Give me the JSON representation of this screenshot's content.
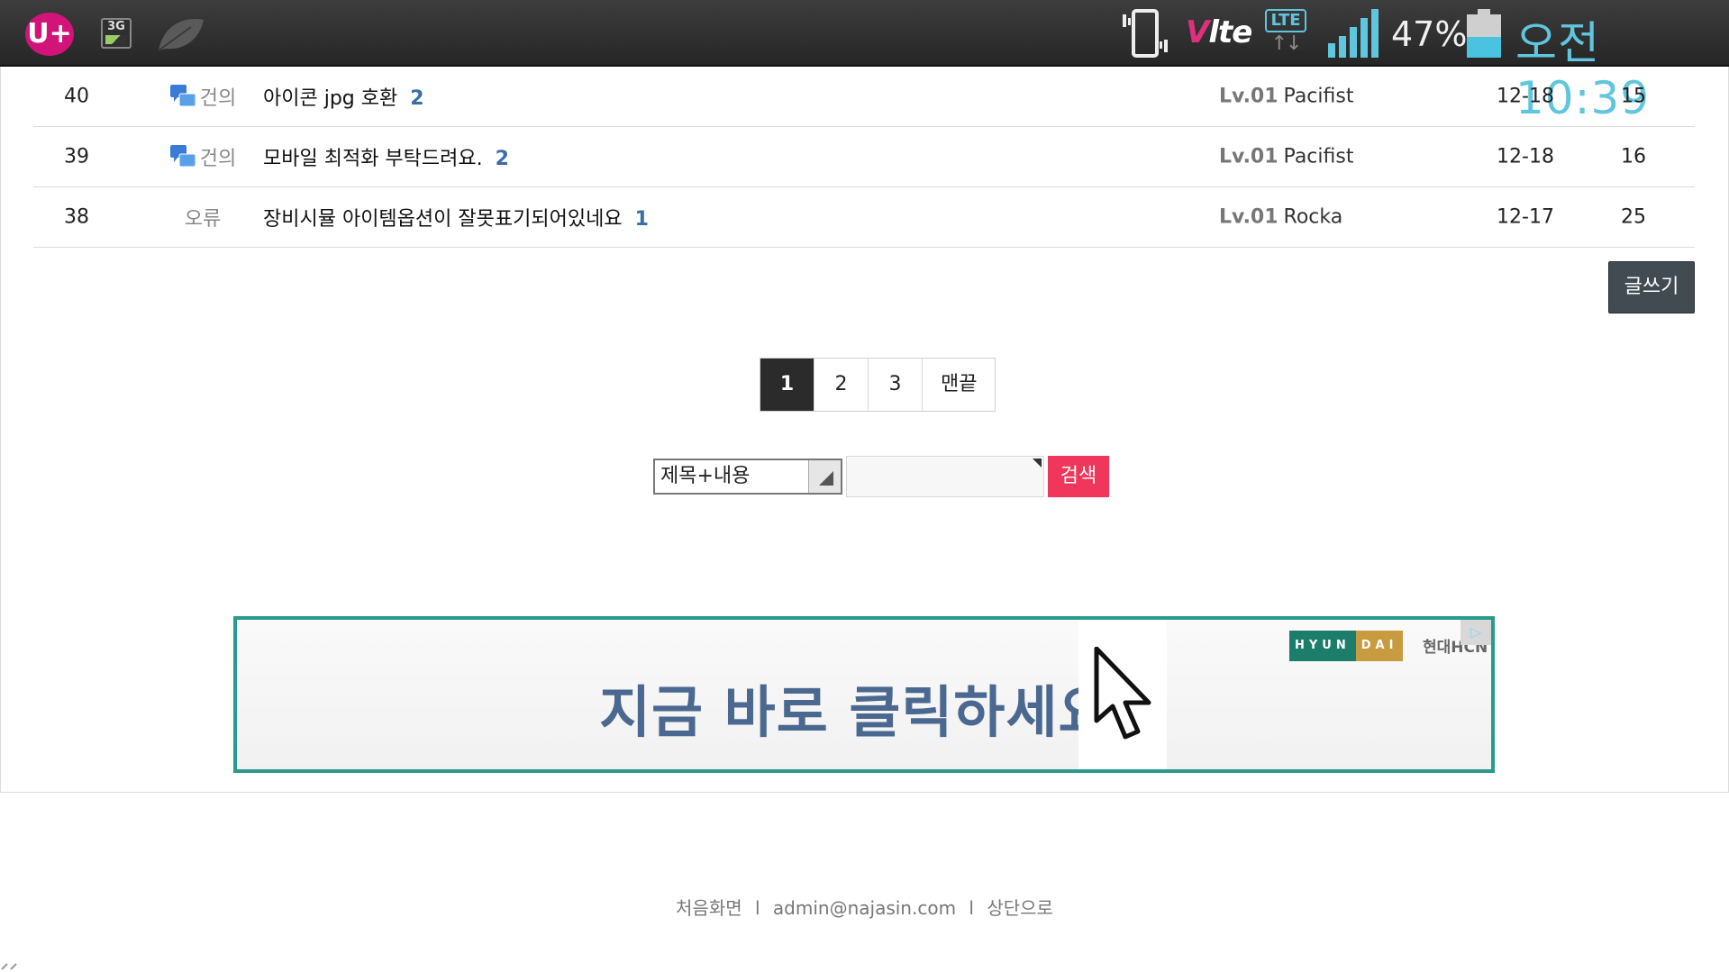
{
  "status_bar": {
    "carrier": "U+",
    "network_icon": "3G",
    "volte": "Volte",
    "lte": "LTE",
    "battery_pct": "47%",
    "battery_level": 0.47,
    "clock": "오전 10:39"
  },
  "board": {
    "rows": [
      {
        "num": "40",
        "category": "건의",
        "category_icon": "chat-icon",
        "title": "아이콘 jpg 호환",
        "comments": "2",
        "level": "Lv.01",
        "author": "Pacifist",
        "date": "12-18",
        "hits": "15"
      },
      {
        "num": "39",
        "category": "건의",
        "category_icon": "chat-icon",
        "title": "모바일 최적화 부탁드려요.",
        "comments": "2",
        "level": "Lv.01",
        "author": "Pacifist",
        "date": "12-18",
        "hits": "16"
      },
      {
        "num": "38",
        "category": "오류",
        "category_icon": "",
        "title": "장비시뮬 아이템옵션이 잘못표기되어있네요",
        "comments": "1",
        "level": "Lv.01",
        "author": "Rocka",
        "date": "12-17",
        "hits": "25"
      }
    ],
    "write_button": "글쓰기"
  },
  "pagination": {
    "pages": [
      "1",
      "2",
      "3"
    ],
    "current": "1",
    "last_label": "맨끝"
  },
  "search": {
    "select_value": "제목+내용",
    "input_value": "",
    "button": "검색"
  },
  "ad": {
    "headline": "지금 바로 클릭하세요!",
    "logo_part1": "HYUN",
    "logo_part2": "DAI",
    "brand": "현대HCN"
  },
  "footer": {
    "home": "처음화면",
    "email": "admin@najasin.com",
    "top": "상단으로",
    "separator": "l"
  },
  "colors": {
    "status_accent": "#5fc6dd",
    "search_button": "#f0365a",
    "write_button": "#424a52",
    "ad_border": "#2a9a8a",
    "comment_count": "#3a6ea5"
  }
}
